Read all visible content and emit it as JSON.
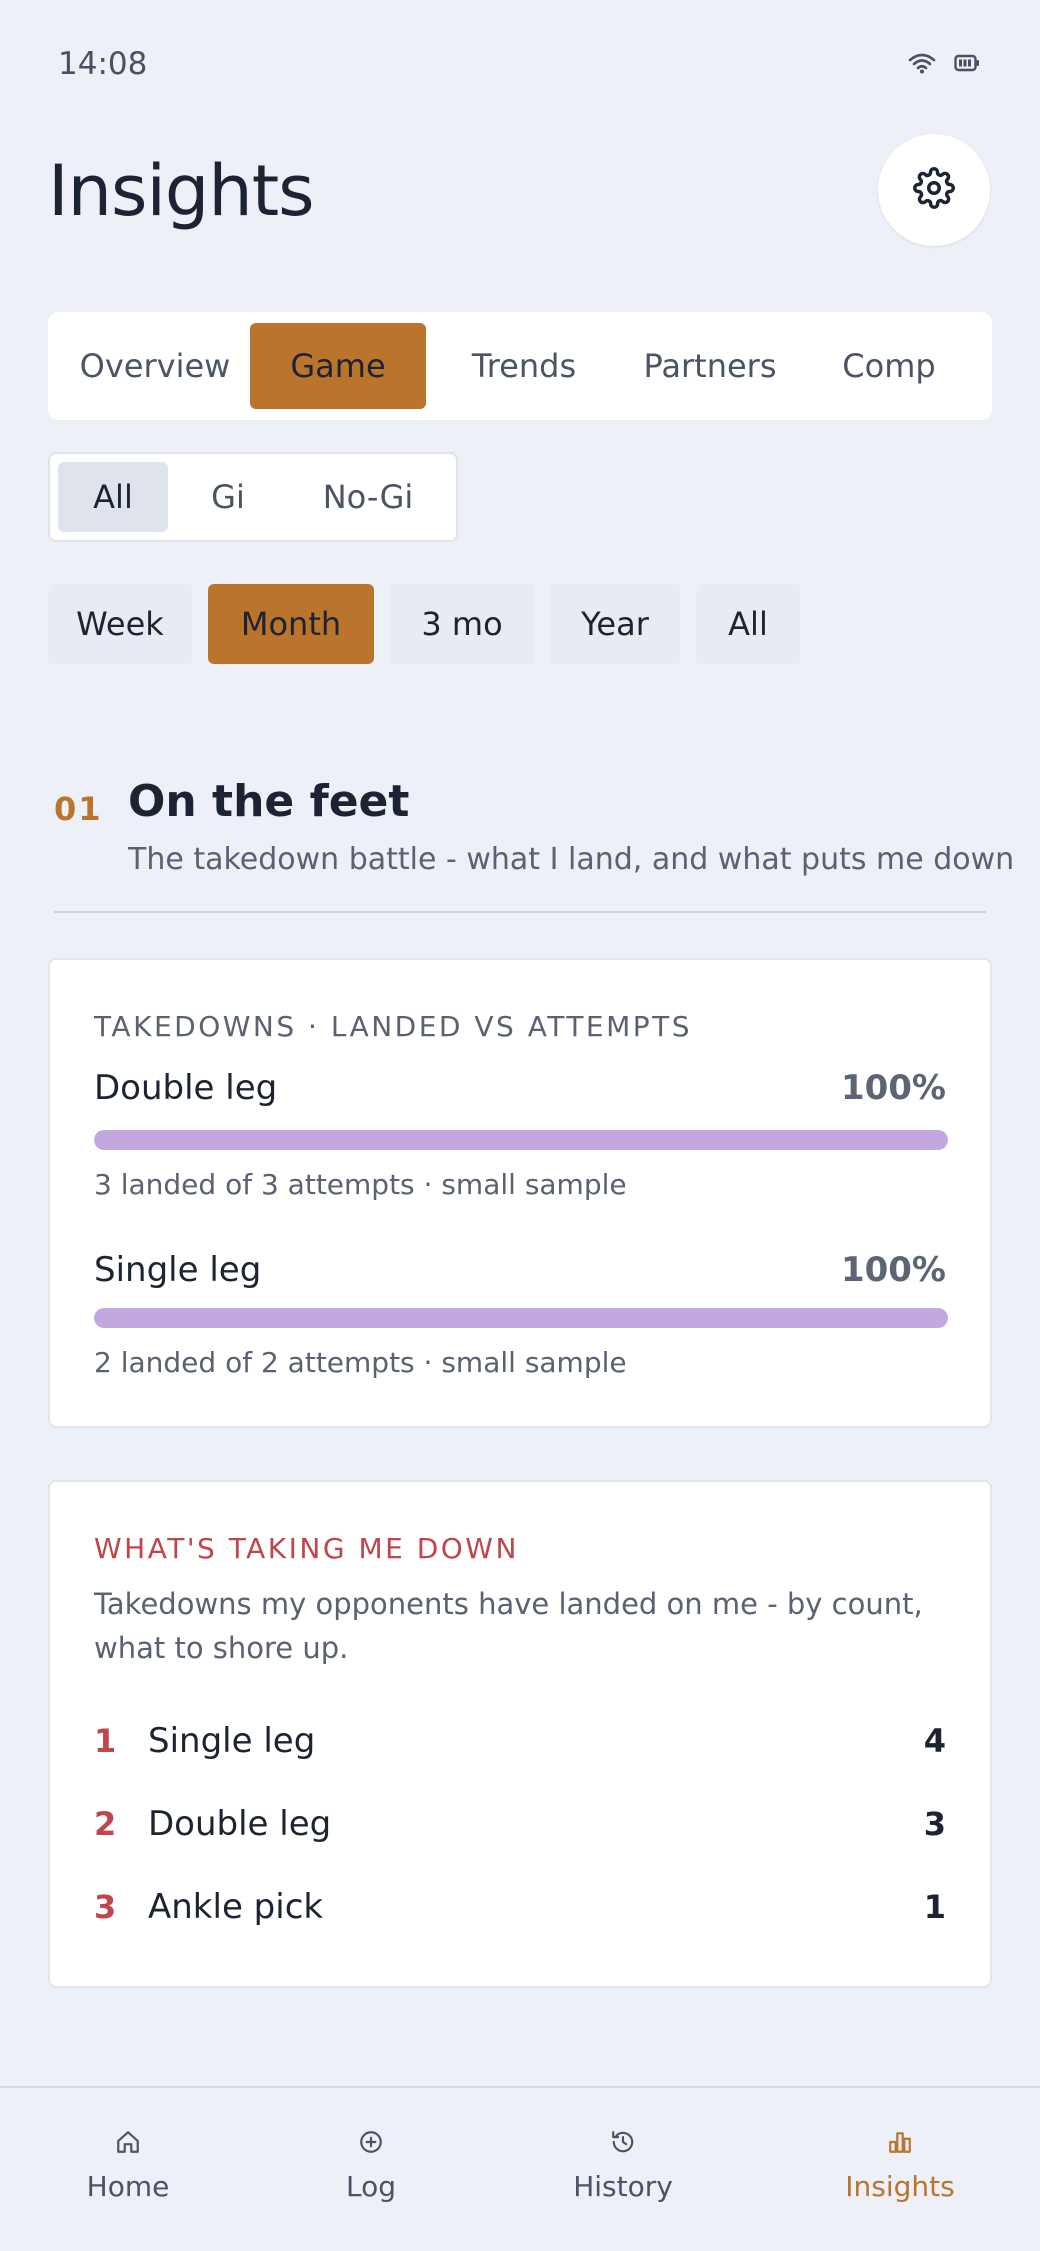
{
  "status_bar": {
    "time": "14:08",
    "icons": [
      "wifi-icon",
      "battery-icon"
    ]
  },
  "header": {
    "title": "Insights",
    "settings_icon": "gear-icon"
  },
  "tabs": [
    {
      "label": "Overview",
      "active": false
    },
    {
      "label": "Game",
      "active": true
    },
    {
      "label": "Trends",
      "active": false
    },
    {
      "label": "Partners",
      "active": false
    },
    {
      "label": "Comp",
      "active": false
    }
  ],
  "gi_filter": [
    {
      "label": "All",
      "active": true
    },
    {
      "label": "Gi",
      "active": false
    },
    {
      "label": "No-Gi",
      "active": false
    }
  ],
  "range_filter": [
    {
      "label": "Week",
      "active": false
    },
    {
      "label": "Month",
      "active": true
    },
    {
      "label": "3 mo",
      "active": false
    },
    {
      "label": "Year",
      "active": false
    },
    {
      "label": "All",
      "active": false
    }
  ],
  "section": {
    "number": "01",
    "title": "On the feet",
    "subtitle": "The takedown battle - what I land, and what puts me down"
  },
  "takedowns_card": {
    "heading": "TAKEDOWNS · LANDED VS ATTEMPTS",
    "items": [
      {
        "name": "Double leg",
        "percent_label": "100%",
        "rate": 1.0,
        "note": "3 landed of 3 attempts · small sample"
      },
      {
        "name": "Single leg",
        "percent_label": "100%",
        "rate": 1.0,
        "note": "2 landed of 2 attempts · small sample"
      }
    ]
  },
  "taken_down_card": {
    "heading": "WHAT'S TAKING ME DOWN",
    "description": "Takedowns my opponents have landed on me - by count, what to shore up.",
    "items": [
      {
        "rank": "1",
        "name": "Single leg",
        "count": "4"
      },
      {
        "rank": "2",
        "name": "Double leg",
        "count": "3"
      },
      {
        "rank": "3",
        "name": "Ankle pick",
        "count": "1"
      }
    ]
  },
  "bottom_nav": [
    {
      "label": "Home",
      "icon": "home-icon",
      "active": false
    },
    {
      "label": "Log",
      "icon": "plus-circle-icon",
      "active": false
    },
    {
      "label": "History",
      "icon": "history-icon",
      "active": false
    },
    {
      "label": "Insights",
      "icon": "bar-chart-icon",
      "active": true
    }
  ],
  "colors": {
    "accent": "#bb742b",
    "danger": "#c0464e",
    "bar_fill": "#c3a8e0",
    "background": "#edf0f7"
  }
}
